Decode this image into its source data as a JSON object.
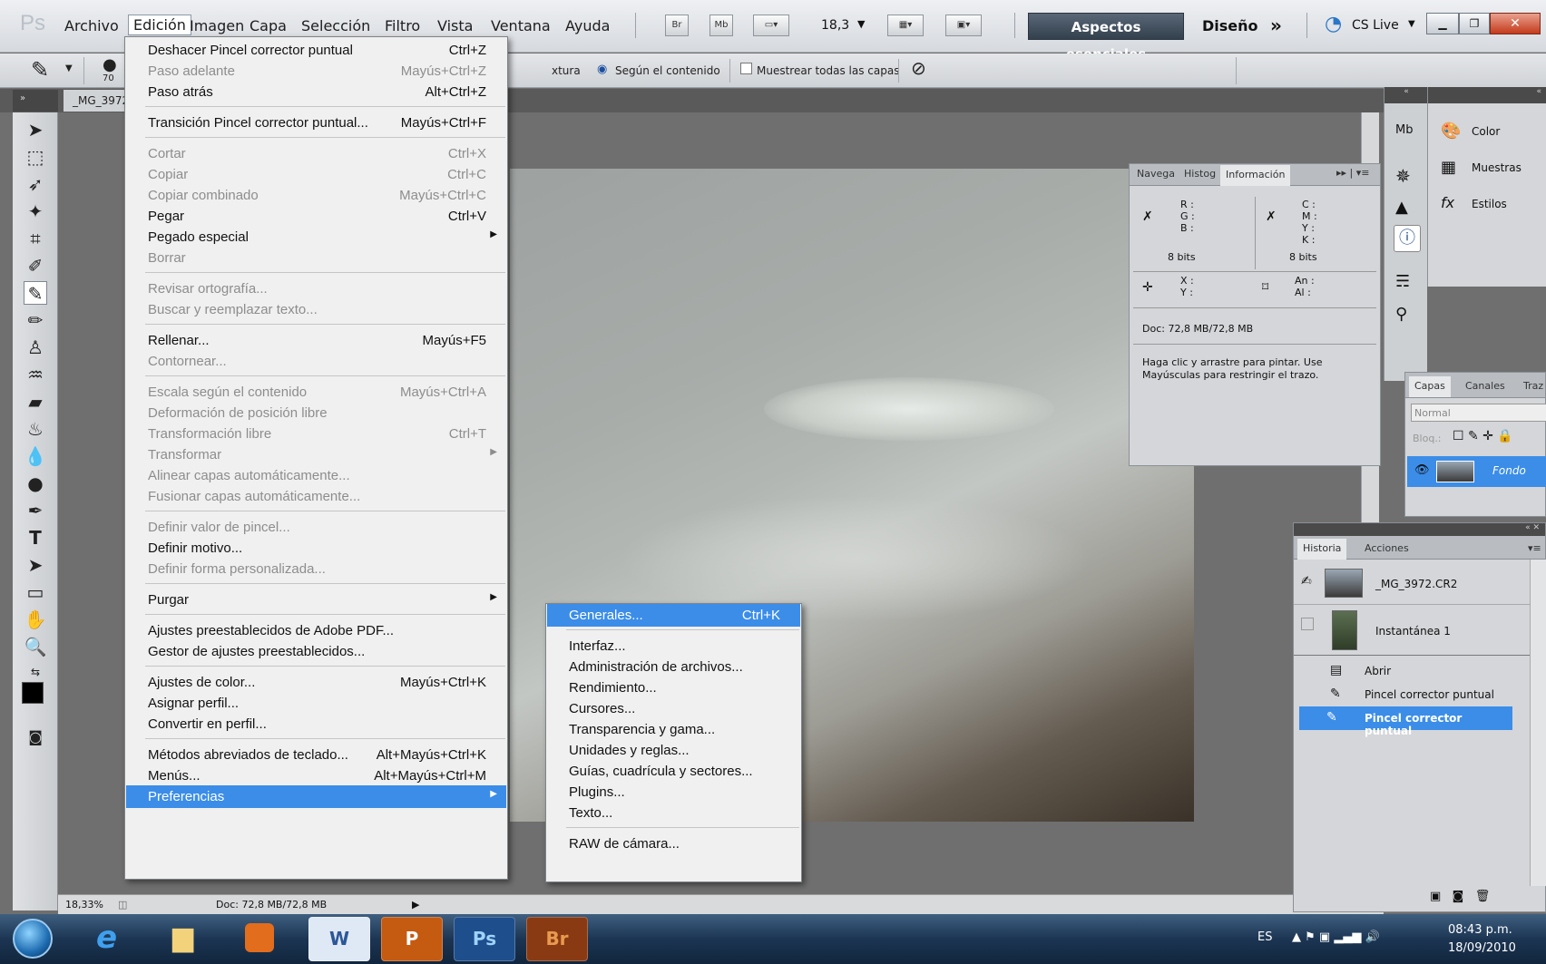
{
  "app": {
    "logo": "Ps"
  },
  "menubar": {
    "items": [
      "Archivo",
      "Edición",
      "Imagen",
      "Capa",
      "Selección",
      "Filtro",
      "Vista",
      "Ventana",
      "Ayuda"
    ],
    "zoom": "18,3",
    "essentials": "Aspectos esenciales",
    "design": "Diseño",
    "more": "»",
    "cslive": "CS Live"
  },
  "options": {
    "brush_size": "70",
    "texture": "xtura",
    "content_aware": "Según el contenido",
    "sample_all": "Muestrear todas las capas"
  },
  "document": {
    "tab": "_MG_3972"
  },
  "edit_menu": [
    {
      "label": "Deshacer Pincel corrector puntual",
      "shortcut": "Ctrl+Z",
      "disabled": false
    },
    {
      "label": "Paso adelante",
      "shortcut": "Mayús+Ctrl+Z",
      "disabled": true
    },
    {
      "label": "Paso atrás",
      "shortcut": "Alt+Ctrl+Z",
      "disabled": false
    },
    {
      "label": "Transición Pincel corrector puntual...",
      "shortcut": "Mayús+Ctrl+F",
      "disabled": false
    },
    {
      "label": "Cortar",
      "shortcut": "Ctrl+X",
      "disabled": true
    },
    {
      "label": "Copiar",
      "shortcut": "Ctrl+C",
      "disabled": true
    },
    {
      "label": "Copiar combinado",
      "shortcut": "Mayús+Ctrl+C",
      "disabled": true
    },
    {
      "label": "Pegar",
      "shortcut": "Ctrl+V",
      "disabled": false
    },
    {
      "label": "Pegado especial",
      "shortcut": "",
      "disabled": false,
      "submenu": true
    },
    {
      "label": "Borrar",
      "shortcut": "",
      "disabled": true
    },
    {
      "label": "Revisar ortografía...",
      "shortcut": "",
      "disabled": true
    },
    {
      "label": "Buscar y reemplazar texto...",
      "shortcut": "",
      "disabled": true
    },
    {
      "label": "Rellenar...",
      "shortcut": "Mayús+F5",
      "disabled": false
    },
    {
      "label": "Contornear...",
      "shortcut": "",
      "disabled": true
    },
    {
      "label": "Escala según el contenido",
      "shortcut": "Mayús+Ctrl+A",
      "disabled": true
    },
    {
      "label": "Deformación de posición libre",
      "shortcut": "",
      "disabled": true
    },
    {
      "label": "Transformación libre",
      "shortcut": "Ctrl+T",
      "disabled": true
    },
    {
      "label": "Transformar",
      "shortcut": "",
      "disabled": true,
      "submenu": true
    },
    {
      "label": "Alinear capas automáticamente...",
      "shortcut": "",
      "disabled": true
    },
    {
      "label": "Fusionar capas automáticamente...",
      "shortcut": "",
      "disabled": true
    },
    {
      "label": "Definir valor de pincel...",
      "shortcut": "",
      "disabled": true
    },
    {
      "label": "Definir motivo...",
      "shortcut": "",
      "disabled": false
    },
    {
      "label": "Definir forma personalizada...",
      "shortcut": "",
      "disabled": true
    },
    {
      "label": "Purgar",
      "shortcut": "",
      "disabled": false,
      "submenu": true
    },
    {
      "label": "Ajustes preestablecidos de Adobe PDF...",
      "shortcut": "",
      "disabled": false
    },
    {
      "label": "Gestor de ajustes preestablecidos...",
      "shortcut": "",
      "disabled": false
    },
    {
      "label": "Ajustes de color...",
      "shortcut": "Mayús+Ctrl+K",
      "disabled": false
    },
    {
      "label": "Asignar perfil...",
      "shortcut": "",
      "disabled": false
    },
    {
      "label": "Convertir en perfil...",
      "shortcut": "",
      "disabled": false
    },
    {
      "label": "Métodos abreviados de teclado...",
      "shortcut": "Alt+Mayús+Ctrl+K",
      "disabled": false
    },
    {
      "label": "Menús...",
      "shortcut": "Alt+Mayús+Ctrl+M",
      "disabled": false
    },
    {
      "label": "Preferencias",
      "shortcut": "",
      "disabled": false,
      "submenu": true,
      "highlighted": true
    }
  ],
  "prefs_menu": [
    {
      "label": "Generales...",
      "shortcut": "Ctrl+K",
      "highlighted": true
    },
    {
      "label": "Interfaz...",
      "shortcut": ""
    },
    {
      "label": "Administración de archivos...",
      "shortcut": ""
    },
    {
      "label": "Rendimiento...",
      "shortcut": ""
    },
    {
      "label": "Cursores...",
      "shortcut": ""
    },
    {
      "label": "Transparencia y gama...",
      "shortcut": ""
    },
    {
      "label": "Unidades y reglas...",
      "shortcut": ""
    },
    {
      "label": "Guías, cuadrícula y sectores...",
      "shortcut": ""
    },
    {
      "label": "Plugins...",
      "shortcut": ""
    },
    {
      "label": "Texto...",
      "shortcut": ""
    },
    {
      "label": "RAW de cámara...",
      "shortcut": ""
    }
  ],
  "info_panel": {
    "tabs": [
      "Navega",
      "Histog",
      "Información"
    ],
    "rgb": [
      "R :",
      "G :",
      "B :"
    ],
    "cmyk": [
      "C :",
      "M :",
      "Y :",
      "K :"
    ],
    "bits_left": "8 bits",
    "bits_right": "8 bits",
    "xy": [
      "X :",
      "Y :"
    ],
    "size": [
      "An :",
      "Al :"
    ],
    "doc": "Doc: 72,8 MB/72,8 MB",
    "hint": "Haga clic y arrastre para pintar. Use Mayúsculas para restringir el trazo."
  },
  "right_dock": {
    "items": [
      "Color",
      "Muestras",
      "Estilos"
    ]
  },
  "layers_panel": {
    "tabs": [
      "Capas",
      "Canales",
      "Traz"
    ],
    "blend": "Normal",
    "lock": "Bloq.:",
    "layer": "Fondo"
  },
  "history_panel": {
    "tabs": [
      "Historia",
      "Acciones"
    ],
    "snapshots": [
      "_MG_3972.CR2",
      "Instantánea 1"
    ],
    "states": [
      "Abrir",
      "Pincel corrector puntual",
      "Pincel corrector puntual"
    ]
  },
  "statusbar": {
    "zoom": "18,33%",
    "doc": "Doc: 72,8 MB/72,8 MB"
  },
  "taskbar": {
    "lang": "ES",
    "time": "08:43 p.m.",
    "date": "18/09/2010",
    "ps": "Ps",
    "br": "Br"
  },
  "colors": {
    "accent": "#3b8de8",
    "highlight_text": "#ffffff"
  }
}
